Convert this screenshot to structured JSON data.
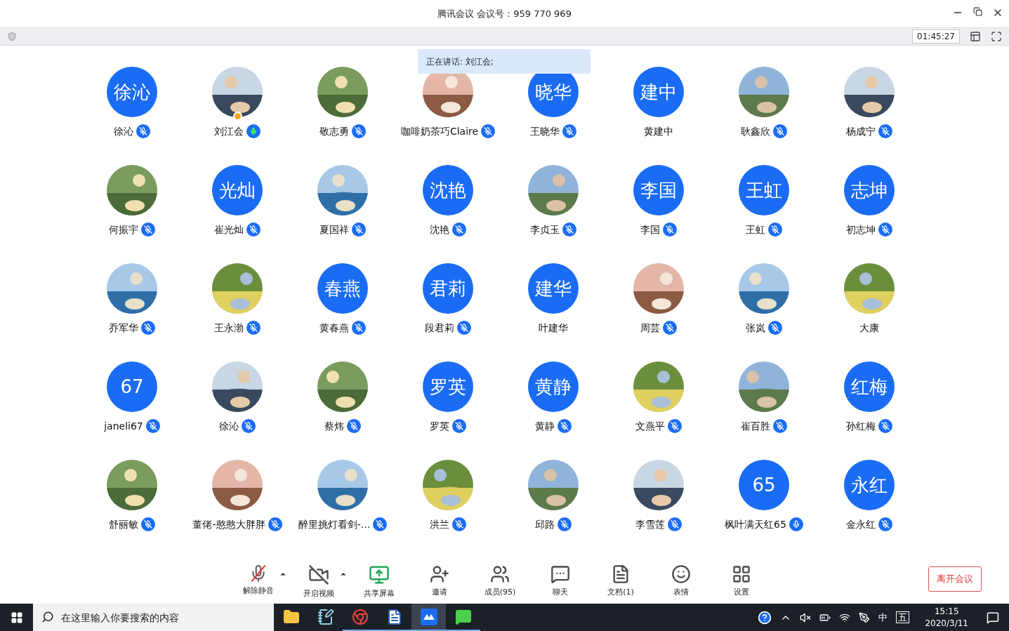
{
  "window": {
    "title": "腾讯会议 会议号：959 770 969"
  },
  "top_bar": {
    "timer": "01:45:27"
  },
  "speaking_banner": "正在讲话: 刘江会;",
  "participants": [
    {
      "name": "徐沁",
      "avatar": {
        "kind": "text",
        "text": "徐沁"
      },
      "mic": {
        "muted": true,
        "speaking": false
      },
      "host": false
    },
    {
      "name": "刘江会",
      "mic": {
        "muted": false,
        "speaking": true
      },
      "host": true
    },
    {
      "name": "敬志勇",
      "mic": {
        "muted": true,
        "speaking": false
      },
      "host": false
    },
    {
      "name": "咖啡奶茶巧Claire",
      "mic": {
        "muted": true,
        "speaking": false
      },
      "host": false
    },
    {
      "name": "王晓华",
      "avatar": {
        "kind": "text",
        "text": "晓华"
      },
      "mic": {
        "muted": true,
        "speaking": false
      },
      "host": false
    },
    {
      "name": "黄建中",
      "avatar": {
        "kind": "text",
        "text": "建中"
      },
      "host": false
    },
    {
      "name": "耿鑫欣",
      "mic": {
        "muted": true,
        "speaking": false
      },
      "host": false
    },
    {
      "name": "杨成宁",
      "mic": {
        "muted": true,
        "speaking": false
      },
      "host": false
    },
    {
      "name": "何振宇",
      "mic": {
        "muted": true,
        "speaking": false
      },
      "host": false
    },
    {
      "name": "崔光灿",
      "avatar": {
        "kind": "text",
        "text": "光灿"
      },
      "mic": {
        "muted": true,
        "speaking": false
      },
      "host": false
    },
    {
      "name": "夏国祥",
      "mic": {
        "muted": true,
        "speaking": false
      },
      "host": false
    },
    {
      "name": "沈艳",
      "avatar": {
        "kind": "text",
        "text": "沈艳"
      },
      "mic": {
        "muted": true,
        "speaking": false
      },
      "host": false
    },
    {
      "name": "李贞玉",
      "mic": {
        "muted": true,
        "speaking": false
      },
      "host": false
    },
    {
      "name": "李国",
      "avatar": {
        "kind": "text",
        "text": "李国"
      },
      "mic": {
        "muted": true,
        "speaking": false
      },
      "host": false
    },
    {
      "name": "王虹",
      "avatar": {
        "kind": "text",
        "text": "王虹"
      },
      "mic": {
        "muted": true,
        "speaking": false
      },
      "host": false
    },
    {
      "name": "初志坤",
      "avatar": {
        "kind": "text",
        "text": "志坤"
      },
      "mic": {
        "muted": true,
        "speaking": false
      },
      "host": false
    },
    {
      "name": "乔军华",
      "mic": {
        "muted": true,
        "speaking": false
      },
      "host": false
    },
    {
      "name": "王永渤",
      "mic": {
        "muted": true,
        "speaking": false
      },
      "host": false
    },
    {
      "name": "黄春燕",
      "avatar": {
        "kind": "text",
        "text": "春燕"
      },
      "mic": {
        "muted": true,
        "speaking": false
      },
      "host": false
    },
    {
      "name": "段君莉",
      "avatar": {
        "kind": "text",
        "text": "君莉"
      },
      "mic": {
        "muted": true,
        "speaking": false
      },
      "host": false
    },
    {
      "name": "叶建华",
      "avatar": {
        "kind": "text",
        "text": "建华"
      },
      "host": false
    },
    {
      "name": "周芸",
      "mic": {
        "muted": true,
        "speaking": false
      },
      "host": false
    },
    {
      "name": "张岚",
      "mic": {
        "muted": true,
        "speaking": false
      },
      "host": false
    },
    {
      "name": "大康",
      "host": false
    },
    {
      "name": "janeli67",
      "avatar": {
        "kind": "text",
        "text": "67"
      },
      "mic": {
        "muted": true,
        "speaking": false
      },
      "host": false
    },
    {
      "name": "徐沁",
      "mic": {
        "muted": true,
        "speaking": false
      },
      "host": false
    },
    {
      "name": "蔡炜",
      "mic": {
        "muted": true,
        "speaking": false
      },
      "host": false
    },
    {
      "name": "罗英",
      "avatar": {
        "kind": "text",
        "text": "罗英"
      },
      "mic": {
        "muted": true,
        "speaking": false
      },
      "host": false
    },
    {
      "name": "黄静",
      "avatar": {
        "kind": "text",
        "text": "黄静"
      },
      "mic": {
        "muted": true,
        "speaking": false
      },
      "host": false
    },
    {
      "name": "文燕平",
      "mic": {
        "muted": true,
        "speaking": false
      },
      "host": false
    },
    {
      "name": "崔百胜",
      "mic": {
        "muted": true,
        "speaking": false
      },
      "host": false
    },
    {
      "name": "孙红梅",
      "avatar": {
        "kind": "text",
        "text": "红梅"
      },
      "mic": {
        "muted": true,
        "speaking": false
      },
      "host": false
    },
    {
      "name": "舒丽敏",
      "mic": {
        "muted": true,
        "speaking": false
      },
      "host": false
    },
    {
      "name": "董佬-憨憨大胖胖",
      "mic": {
        "muted": true,
        "speaking": false
      },
      "host": false
    },
    {
      "name": "醉里挑灯看剑-...",
      "mic": {
        "muted": true,
        "speaking": false
      },
      "host": false
    },
    {
      "name": "洪兰",
      "mic": {
        "muted": true,
        "speaking": false
      },
      "host": false
    },
    {
      "name": "邱路",
      "mic": {
        "muted": true,
        "speaking": false
      },
      "host": false
    },
    {
      "name": "李雪莲",
      "mic": {
        "muted": true,
        "speaking": false
      },
      "host": false
    },
    {
      "name": "枫叶满天红65",
      "avatar": {
        "kind": "text",
        "text": "65"
      },
      "mic": {
        "muted": false,
        "speaking": false
      },
      "host": false
    },
    {
      "name": "金永红",
      "avatar": {
        "kind": "text",
        "text": "永红"
      },
      "mic": {
        "muted": true,
        "speaking": false
      },
      "host": false
    }
  ],
  "toolbar": [
    {
      "kind": "mic",
      "label": "解除静音",
      "caret": true
    },
    {
      "kind": "video",
      "label": "开启视频",
      "caret": true
    },
    {
      "kind": "share",
      "label": "共享屏幕",
      "caret": false
    },
    {
      "kind": "invite",
      "label": "邀请",
      "caret": false
    },
    {
      "kind": "members",
      "label": "成员(95)",
      "caret": false
    },
    {
      "kind": "chat",
      "label": "聊天",
      "caret": false
    },
    {
      "kind": "docs",
      "label": "文档(1)",
      "caret": false
    },
    {
      "kind": "emoji",
      "label": "表情",
      "caret": false
    },
    {
      "kind": "settings",
      "label": "设置",
      "caret": false
    }
  ],
  "leave_button": "离开会议",
  "taskbar": {
    "search_placeholder": "在这里输入你要搜索的内容",
    "apps": [
      {
        "kind": "folder",
        "running": false,
        "selected": false
      },
      {
        "kind": "notepad",
        "running": false,
        "selected": false
      },
      {
        "kind": "chrome",
        "running": true,
        "selected": false
      },
      {
        "kind": "word",
        "running": true,
        "selected": false
      },
      {
        "kind": "meeting",
        "running": true,
        "selected": true
      },
      {
        "kind": "wechat",
        "running": true,
        "selected": false
      }
    ],
    "ime_mode": "中",
    "ime_name": "五",
    "time": "15:15",
    "date": "2020/3/11"
  }
}
